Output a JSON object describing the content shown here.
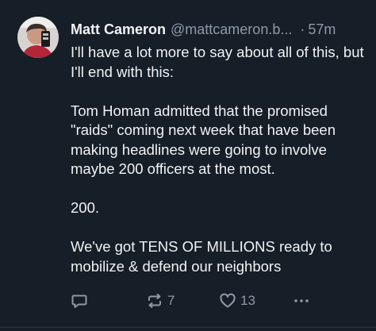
{
  "author": {
    "display_name": "Matt Cameron",
    "handle": "@mattcameron.b...",
    "separator": "·",
    "time": "57m",
    "avatar_icon": "user-avatar"
  },
  "post": {
    "paragraphs": [
      "I'll have a lot more to say about all of this, but I'll end with this:",
      "Tom Homan admitted that the promised \"raids\" coming next week that have been making headlines were going to involve maybe 200 officers at the most.",
      "200.",
      "We've got TENS OF MILLIONS ready to mobilize & defend our neighbors"
    ]
  },
  "actions": {
    "reply": {
      "icon": "reply-icon"
    },
    "repost": {
      "icon": "repost-icon",
      "count": "7"
    },
    "like": {
      "icon": "heart-icon",
      "count": "13"
    },
    "more": {
      "icon": "more-icon"
    }
  },
  "colors": {
    "background": "#161e27",
    "text": "#f1f3f5",
    "muted": "#8c9aa8"
  }
}
